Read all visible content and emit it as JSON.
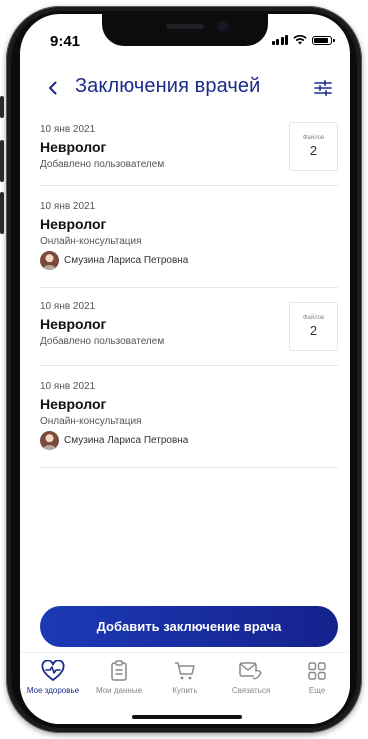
{
  "status_bar": {
    "time": "9:41"
  },
  "header": {
    "title": "Заключения врачей"
  },
  "records": [
    {
      "date": "10 янв 2021",
      "specialty": "Невролог",
      "subtitle": "Добавлено пользователем",
      "files_label": "Файлов",
      "files_count": "2"
    },
    {
      "date": "10 янв 2021",
      "specialty": "Невролог",
      "subtitle": "Онлайн-консультация",
      "doctor": "Смузина Лариса Петровна"
    },
    {
      "date": "10 янв 2021",
      "specialty": "Невролог",
      "subtitle": "Добавлено пользователем",
      "files_label": "Файлов",
      "files_count": "2"
    },
    {
      "date": "10 янв 2021",
      "specialty": "Невролог",
      "subtitle": "Онлайн-консультация",
      "doctor": "Смузина Лариса Петровна"
    }
  ],
  "add_button": {
    "label": "Добавить заключение врача"
  },
  "tabbar": {
    "items": [
      {
        "label": "Мое здоровье",
        "icon": "heart-pulse-icon",
        "active": true
      },
      {
        "label": "Мои данные",
        "icon": "clipboard-icon",
        "active": false
      },
      {
        "label": "Купить",
        "icon": "cart-icon",
        "active": false
      },
      {
        "label": "Связаться",
        "icon": "message-phone-icon",
        "active": false
      },
      {
        "label": "Еще",
        "icon": "grid-icon",
        "active": false
      }
    ]
  },
  "colors": {
    "accent": "#1b2b8a",
    "button_start": "#1c3ab6",
    "button_end": "#14228c",
    "divider": "#e4e4ea"
  }
}
